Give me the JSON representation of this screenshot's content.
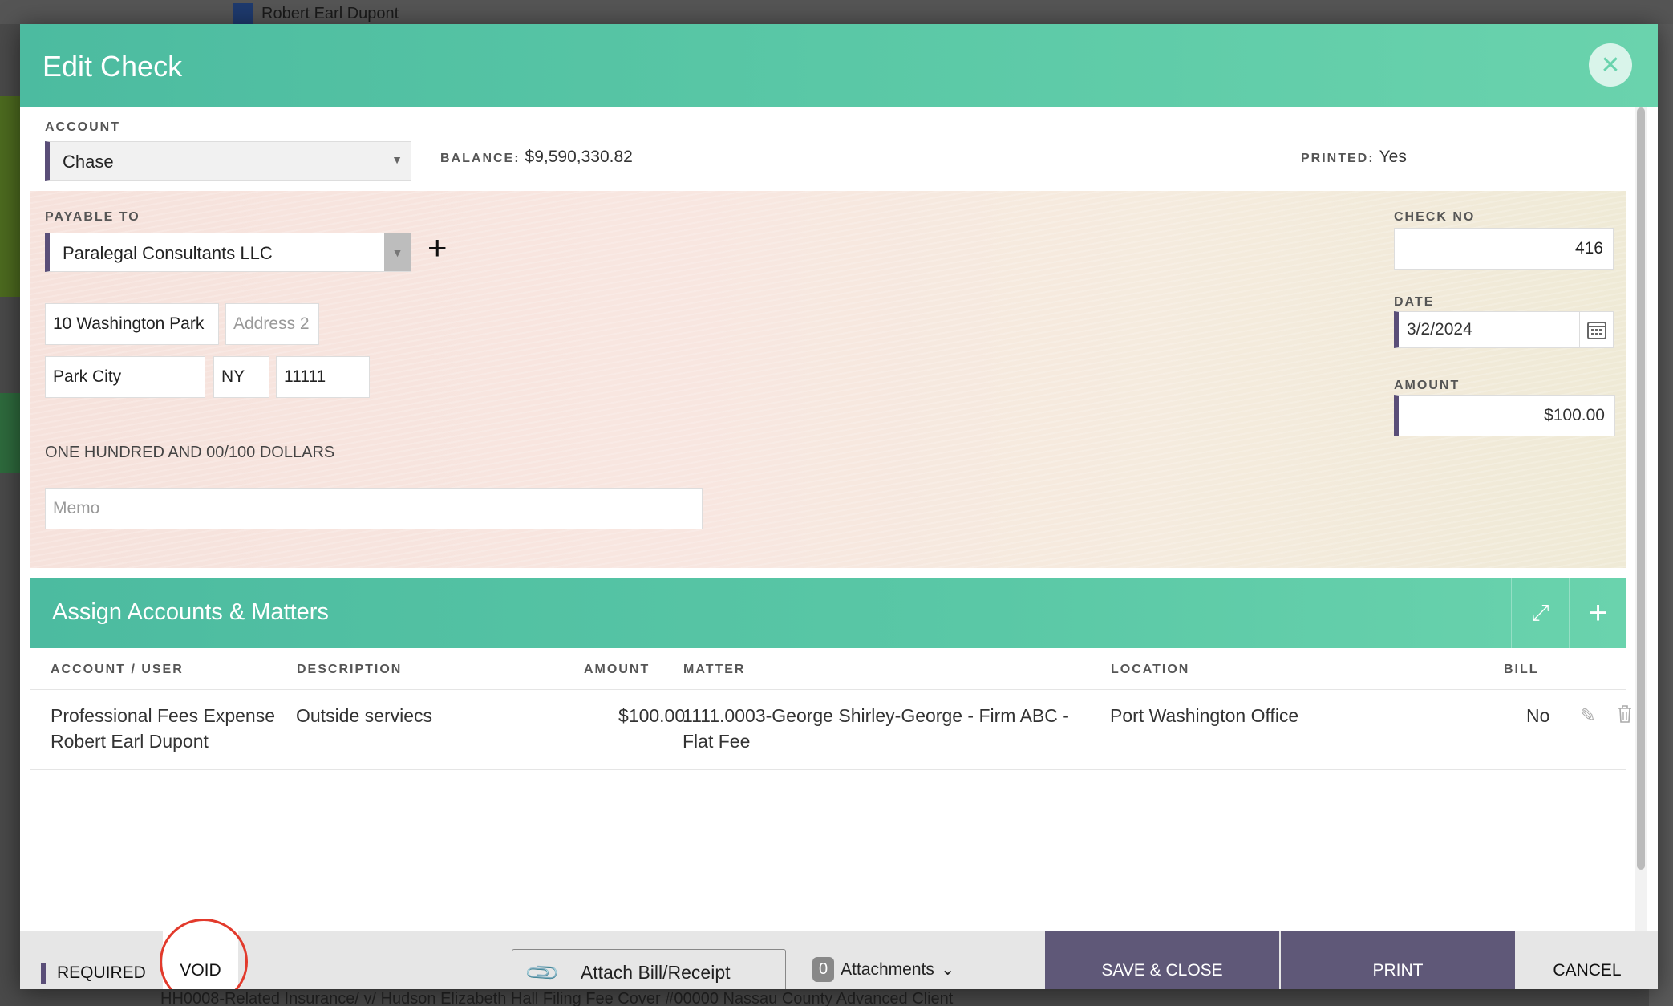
{
  "background": {
    "top_user": "Robert Earl Dupont",
    "bottom_row": "HH0008-Related Insurance/ v/ Hudson        Elizabeth Hall          Filing Fee Cover #00000           Nassau County        Advanced Client"
  },
  "modal": {
    "title": "Edit Check",
    "close_icon": "close-icon"
  },
  "form": {
    "account_label": "ACCOUNT",
    "account_value": "Chase",
    "balance_label": "BALANCE:",
    "balance_value": "$9,590,330.82",
    "printed_label": "PRINTED:",
    "printed_value": "Yes",
    "payable_label": "PAYABLE TO",
    "payable_value": "Paralegal Consultants LLC",
    "address1": "10 Washington Park",
    "address2_placeholder": "Address 2",
    "city": "Park City",
    "state": "NY",
    "zip": "11111",
    "amount_words": "ONE HUNDRED AND 00/100 DOLLARS",
    "memo_placeholder": "Memo",
    "check_no_label": "CHECK NO",
    "check_no": "416",
    "date_label": "DATE",
    "date": "3/2/2024",
    "amount_label": "AMOUNT",
    "amount": "$100.00"
  },
  "assign": {
    "title": "Assign Accounts & Matters",
    "columns": [
      "ACCOUNT / USER",
      "DESCRIPTION",
      "AMOUNT",
      "MATTER",
      "LOCATION",
      "BILL"
    ],
    "rows": [
      {
        "account": "Professional Fees Expense",
        "user": "Robert Earl Dupont",
        "description": "Outside serviecs",
        "amount": "$100.00",
        "matter_line1": "1111.0003-George Shirley-George - Firm ABC -",
        "matter_line2": "Flat Fee",
        "location": "Port Washington Office",
        "bill": "No"
      }
    ]
  },
  "footer": {
    "required_label": "REQUIRED",
    "void_label": "VOID",
    "attach_label": "Attach Bill/Receipt",
    "attachments_count": "0",
    "attachments_label": "Attachments",
    "save_close_label": "SAVE & CLOSE",
    "print_label": "PRINT",
    "cancel_label": "CANCEL"
  },
  "colors": {
    "header_green": "#5ac8a6",
    "accent_purple": "#5f5878",
    "void_highlight": "#e23a2c"
  }
}
